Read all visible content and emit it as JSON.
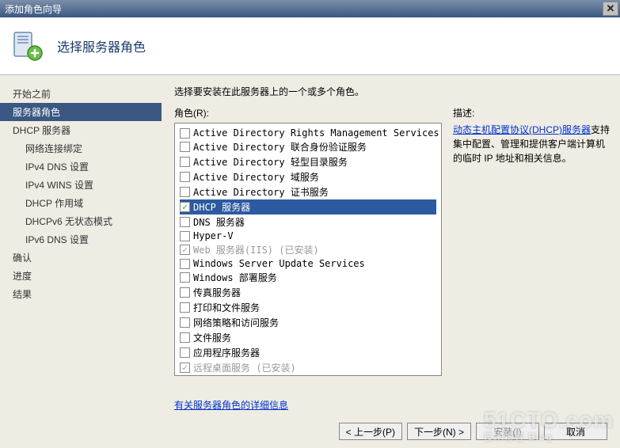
{
  "titlebar": {
    "text": "添加角色向导"
  },
  "header": {
    "title": "选择服务器角色"
  },
  "sidebar": {
    "items": [
      {
        "label": "开始之前",
        "sub": false,
        "selected": false
      },
      {
        "label": "服务器角色",
        "sub": false,
        "selected": true
      },
      {
        "label": "DHCP 服务器",
        "sub": false,
        "selected": false
      },
      {
        "label": "网络连接绑定",
        "sub": true,
        "selected": false
      },
      {
        "label": "IPv4 DNS 设置",
        "sub": true,
        "selected": false
      },
      {
        "label": "IPv4 WINS 设置",
        "sub": true,
        "selected": false
      },
      {
        "label": "DHCP 作用域",
        "sub": true,
        "selected": false
      },
      {
        "label": "DHCPv6 无状态模式",
        "sub": true,
        "selected": false
      },
      {
        "label": "IPv6 DNS 设置",
        "sub": true,
        "selected": false
      },
      {
        "label": "确认",
        "sub": false,
        "selected": false
      },
      {
        "label": "进度",
        "sub": false,
        "selected": false
      },
      {
        "label": "结果",
        "sub": false,
        "selected": false
      }
    ]
  },
  "main": {
    "instruction": "选择要安装在此服务器上的一个或多个角色。",
    "roles_label": "角色(R):",
    "roles": [
      {
        "label": "Active Directory Rights Management Services",
        "checked": false,
        "disabled": false,
        "selected": false
      },
      {
        "label": "Active Directory 联合身份验证服务",
        "checked": false,
        "disabled": false,
        "selected": false
      },
      {
        "label": "Active Directory 轻型目录服务",
        "checked": false,
        "disabled": false,
        "selected": false
      },
      {
        "label": "Active Directory 域服务",
        "checked": false,
        "disabled": false,
        "selected": false
      },
      {
        "label": "Active Directory 证书服务",
        "checked": false,
        "disabled": false,
        "selected": false
      },
      {
        "label": "DHCP 服务器",
        "checked": true,
        "disabled": false,
        "selected": true
      },
      {
        "label": "DNS 服务器",
        "checked": false,
        "disabled": false,
        "selected": false
      },
      {
        "label": "Hyper-V",
        "checked": false,
        "disabled": false,
        "selected": false
      },
      {
        "label": "Web 服务器(IIS)  (已安装)",
        "checked": true,
        "disabled": true,
        "selected": false
      },
      {
        "label": "Windows Server Update Services",
        "checked": false,
        "disabled": false,
        "selected": false
      },
      {
        "label": "Windows 部署服务",
        "checked": false,
        "disabled": false,
        "selected": false
      },
      {
        "label": "传真服务器",
        "checked": false,
        "disabled": false,
        "selected": false
      },
      {
        "label": "打印和文件服务",
        "checked": false,
        "disabled": false,
        "selected": false
      },
      {
        "label": "网络策略和访问服务",
        "checked": false,
        "disabled": false,
        "selected": false
      },
      {
        "label": "文件服务",
        "checked": false,
        "disabled": false,
        "selected": false
      },
      {
        "label": "应用程序服务器",
        "checked": false,
        "disabled": false,
        "selected": false
      },
      {
        "label": "远程桌面服务  (已安装)",
        "checked": true,
        "disabled": true,
        "selected": false
      }
    ],
    "desc_label": "描述:",
    "desc_link": "动态主机配置协议(DHCP)服务器",
    "desc_rest": "支持集中配置、管理和提供客户端计算机的临时 IP 地址和相关信息。",
    "more_link": "有关服务器角色的详细信息"
  },
  "buttons": {
    "prev": "< 上一步(P)",
    "next": "下一步(N) >",
    "install": "安装(I)",
    "cancel": "取消"
  },
  "watermark": {
    "main": "51CTO.com",
    "sub": "技术博客  Blog"
  }
}
